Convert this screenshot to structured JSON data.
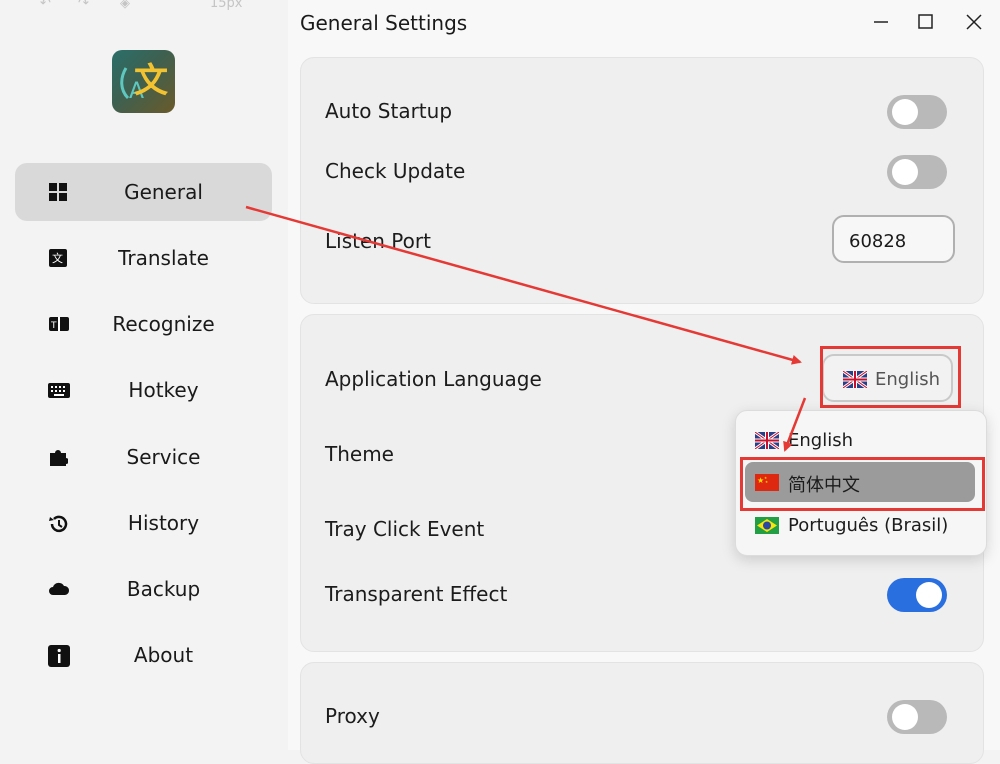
{
  "background_toolbar": {
    "zoom_text": "15px"
  },
  "window": {
    "title": "General Settings",
    "controls": [
      "minimize",
      "maximize",
      "close"
    ]
  },
  "sidebar": {
    "items": [
      {
        "label": "General",
        "icon": "grid-icon",
        "active": true
      },
      {
        "label": "Translate",
        "icon": "translate-icon",
        "active": false
      },
      {
        "label": "Recognize",
        "icon": "ocr-icon",
        "active": false
      },
      {
        "label": "Hotkey",
        "icon": "keyboard-icon",
        "active": false
      },
      {
        "label": "Service",
        "icon": "puzzle-icon",
        "active": false
      },
      {
        "label": "History",
        "icon": "history-icon",
        "active": false
      },
      {
        "label": "Backup",
        "icon": "cloud-icon",
        "active": false
      },
      {
        "label": "About",
        "icon": "info-icon",
        "active": false
      }
    ]
  },
  "settings": {
    "auto_startup": {
      "label": "Auto Startup",
      "enabled": false
    },
    "check_update": {
      "label": "Check Update",
      "enabled": false
    },
    "listen_port": {
      "label": "Listen Port",
      "value": "60828"
    },
    "app_language": {
      "label": "Application Language",
      "value": "English"
    },
    "theme": {
      "label": "Theme"
    },
    "tray_click": {
      "label": "Tray Click Event"
    },
    "transparent": {
      "label": "Transparent Effect",
      "enabled": true
    },
    "proxy": {
      "label": "Proxy",
      "enabled": false
    }
  },
  "language_dropdown": {
    "options": [
      {
        "label": "English",
        "flag": "uk-flag"
      },
      {
        "label": "简体中文",
        "flag": "china-flag",
        "highlighted": true
      },
      {
        "label": "Português (Brasil)",
        "flag": "brazil-flag"
      }
    ]
  },
  "colors": {
    "accent": "#2a6fe0",
    "annotation": "#e53935"
  }
}
